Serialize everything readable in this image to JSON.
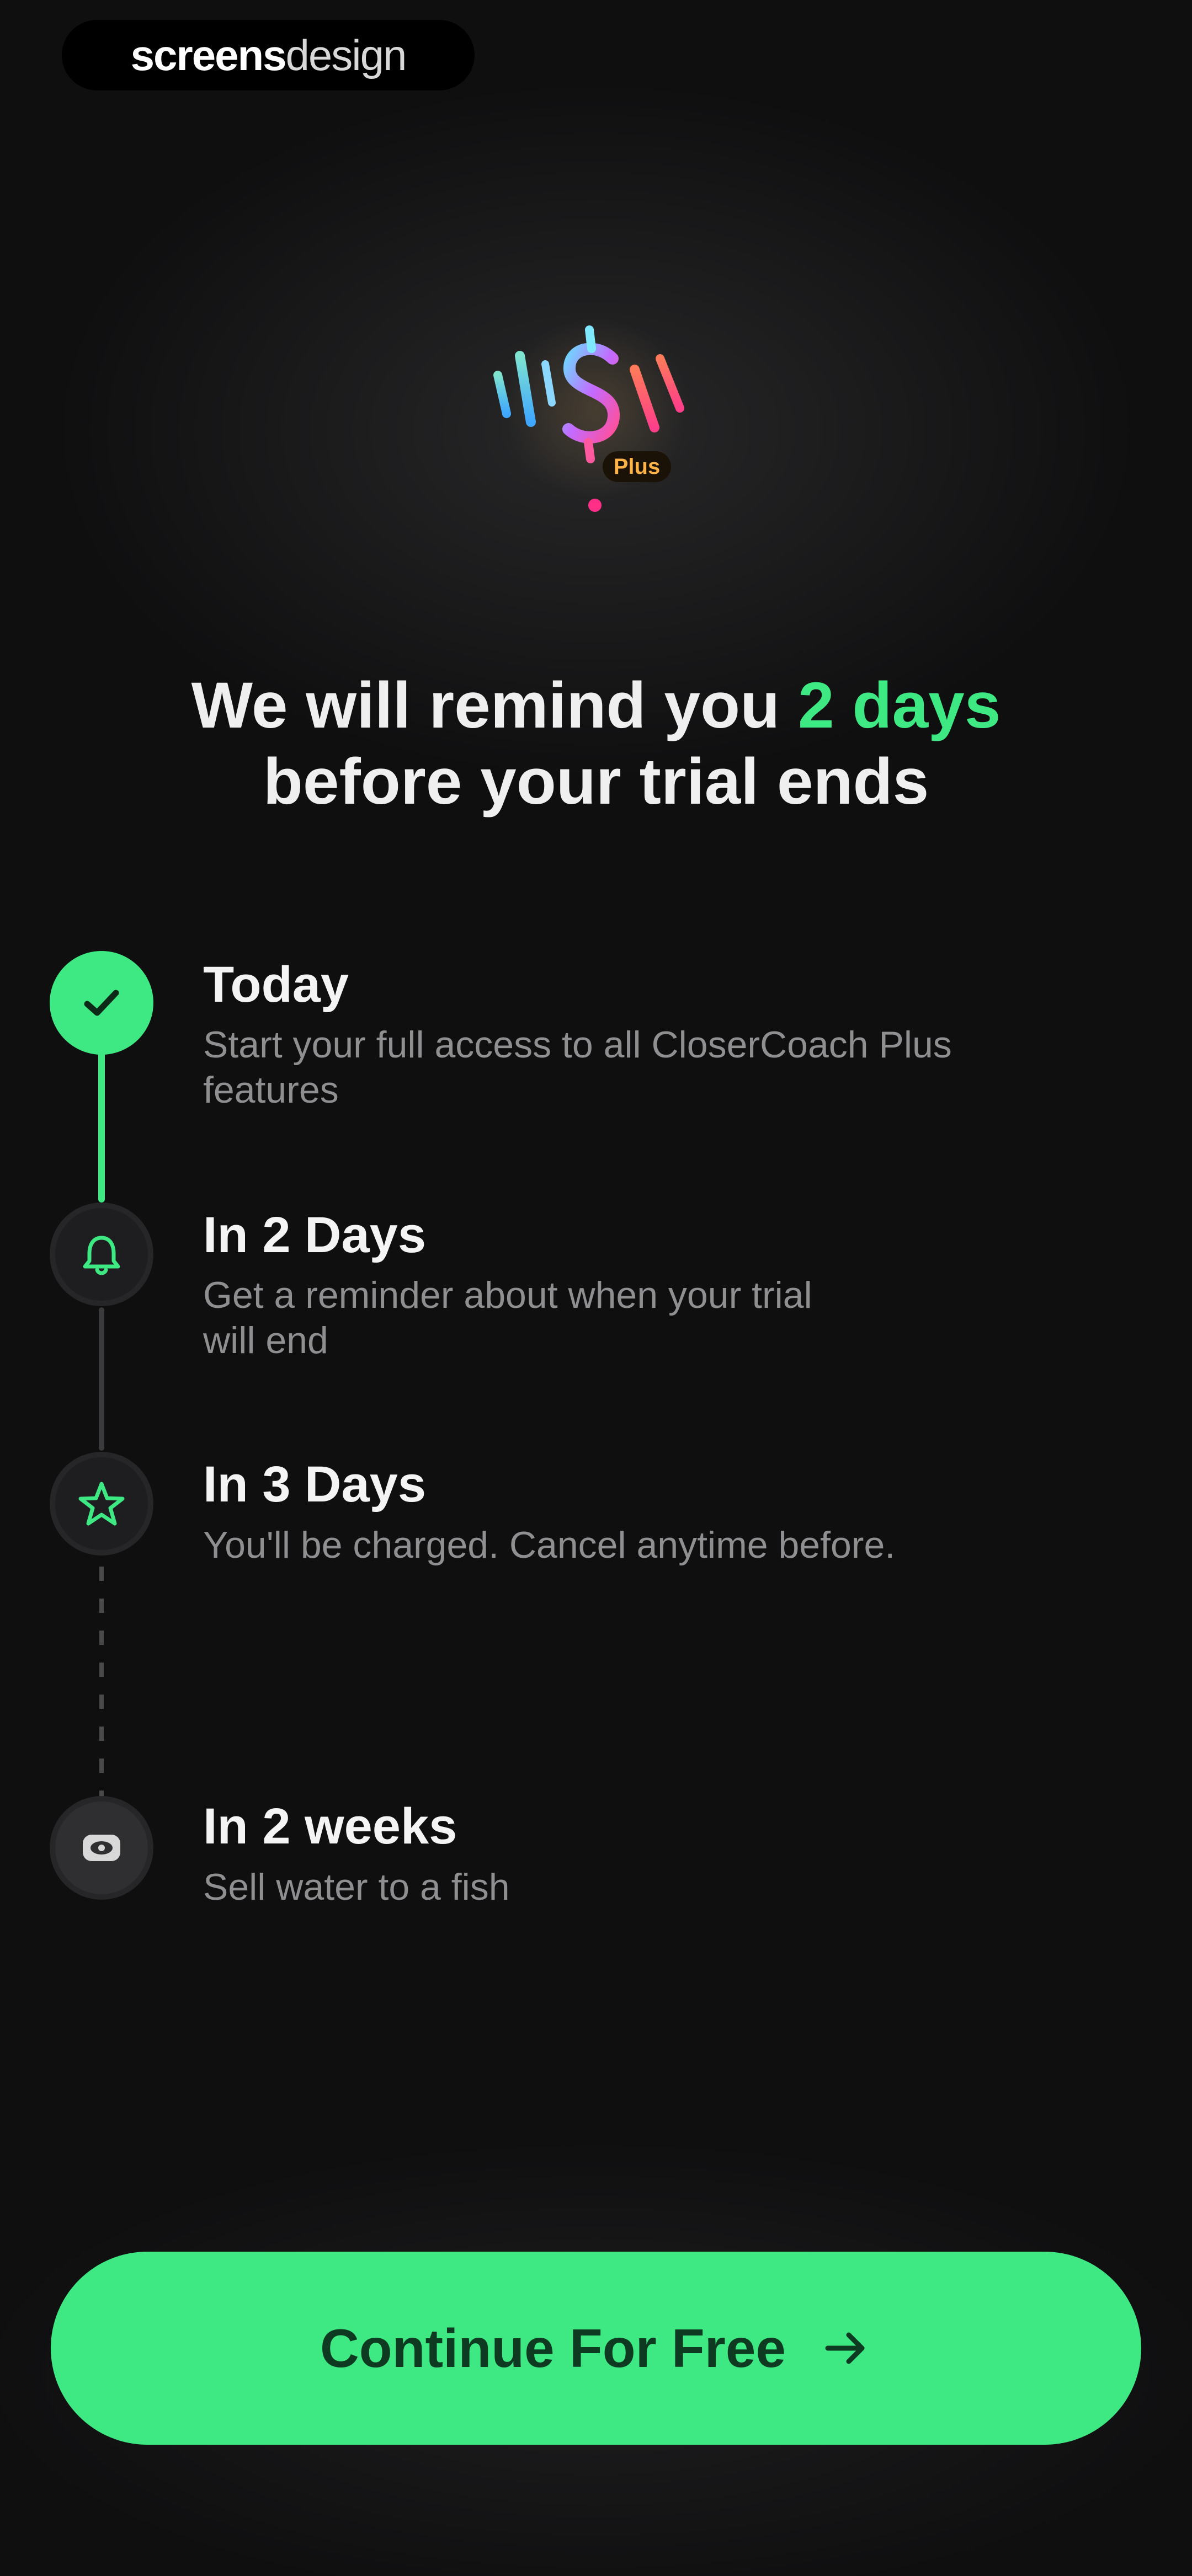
{
  "watermark": {
    "bold_part": "screens",
    "light_part": "design"
  },
  "logo": {
    "icon": "dollar-sign-logo-icon",
    "badge_text": "Plus"
  },
  "headline": {
    "prefix": "We will remind you ",
    "highlight": "2 days",
    "line2": "before your trial ends"
  },
  "timeline": [
    {
      "title": "Today",
      "description": "Start your full access to all CloserCoach Plus features",
      "icon": "checkmark-icon",
      "state": "completed"
    },
    {
      "title": "In 2 Days",
      "description": "Get a reminder about when your trial will end",
      "icon": "bell-icon",
      "state": "upcoming"
    },
    {
      "title": "In 3 Days",
      "description": "You'll be charged. Cancel anytime before.",
      "icon": "star-icon",
      "state": "upcoming"
    },
    {
      "title": "In 2 weeks",
      "description": "Sell water to a fish",
      "icon": "eye-icon",
      "state": "future"
    }
  ],
  "cta": {
    "label": "Continue For Free",
    "icon": "arrow-right-icon"
  },
  "colors": {
    "accent": "#3ee883",
    "background": "#0f0f10",
    "cta_text": "#0f3a22"
  }
}
